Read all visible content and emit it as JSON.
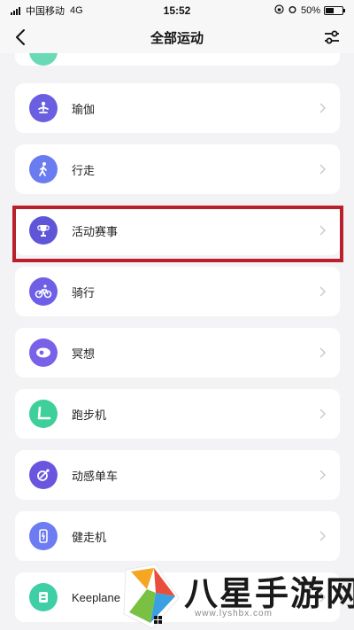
{
  "status_bar": {
    "carrier": "中国移动",
    "network": "4G",
    "time": "15:52",
    "battery": "50%",
    "battery_level": 0.5
  },
  "nav": {
    "title": "全部运动",
    "back_icon": "chevron-left-icon",
    "filter_icon": "sliders-icon"
  },
  "activities": [
    {
      "label": "瑜伽",
      "icon": "yoga-icon",
      "color": "#6a5fe0"
    },
    {
      "label": "行走",
      "icon": "walking-icon",
      "color": "#6b7cf0"
    },
    {
      "label": "活动赛事",
      "icon": "trophy-icon",
      "color": "#5f55d8"
    },
    {
      "label": "骑行",
      "icon": "cycling-icon",
      "color": "#6f5fe6"
    },
    {
      "label": "冥想",
      "icon": "meditation-icon",
      "color": "#7a62e8"
    },
    {
      "label": "跑步机",
      "icon": "treadmill-icon",
      "color": "#3fcf9a"
    },
    {
      "label": "动感单车",
      "icon": "spinning-bike-icon",
      "color": "#6a55de"
    },
    {
      "label": "健走机",
      "icon": "walking-machine-icon",
      "color": "#6d7cf2"
    },
    {
      "label": "Keeplane",
      "icon": "keeplane-icon",
      "color": "#3fcfa6"
    }
  ],
  "watermark": {
    "text": "八星手游网",
    "url": "www.lyshbx.com"
  },
  "colors": {
    "highlight": "#b8202c",
    "background": "#f3f3f5"
  }
}
